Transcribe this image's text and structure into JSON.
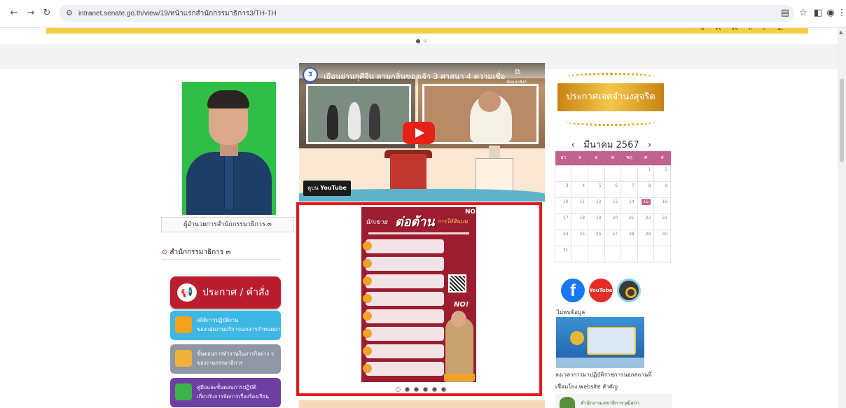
{
  "browser": {
    "url": "intranet.senate.go.th/view/19/หน้าแรกสำนักกรรมาธิการ3/TH-TH"
  },
  "left": {
    "portrait_caption": "ผู้อำนวยการสำนักกรรมาธิการ ๓",
    "section_title": "สำนักกรรมาธิการ ๓",
    "announce_label": "ประกาศ / คำสั่ง",
    "buttons": [
      {
        "line1": "สถิติการปฏิบัติงาน",
        "line2": "ของกลุ่มงานบริการเอกสารกำหนดมา",
        "color": "#3fb7e4",
        "icon_color": "#f4a31b"
      },
      {
        "line1": "ขั้นตอนการทำงานในภารกิจต่าง ๆ",
        "line2": "ของงานกรรมาธิการ",
        "color": "#8e97a3",
        "icon_color": "#f0b339"
      },
      {
        "line1": "คู่มือและขั้นตอนการปฏิบัติ",
        "line2": "เกี่ยวกับการจัดการเรื่องร้องเรียน",
        "color": "#6e3fa3",
        "icon_color": "#3bb34a"
      }
    ]
  },
  "center": {
    "video": {
      "channel_badge": "3",
      "title": "เยือนย่านกุศีจีน ตามกลิ่นของเจ้า 3 ศาสนา 4 ความเชื่อ",
      "copy_label": "คัดลอกลิงก์",
      "watch_label": "ดูบน",
      "youtube_label": "YouTube"
    },
    "poster": {
      "title_a": "นักเขาย",
      "title_b": "ต่อต้าน",
      "title_c": "การให้สินบน",
      "no_badge": "NO",
      "no_stamp": "NO!",
      "rows": 8
    },
    "carousel": {
      "total": 6,
      "active": 0
    }
  },
  "right": {
    "integrity_label": "ประกาศเจตจำนงสุจริต",
    "calendar": {
      "prev": "‹",
      "next": "›",
      "month_year": "มีนาคม 2567",
      "weekdays": [
        "อา",
        "จ",
        "อ",
        "พ",
        "พฤ",
        "ศ",
        "ส"
      ],
      "weeks": [
        [
          "",
          "",
          "",
          "",
          "",
          "1",
          "2"
        ],
        [
          "3",
          "4",
          "5",
          "6",
          "7",
          "8",
          "9"
        ],
        [
          "10",
          "11",
          "12",
          "13",
          "14",
          "15",
          "16"
        ],
        [
          "17",
          "18",
          "19",
          "20",
          "21",
          "22",
          "23"
        ],
        [
          "24",
          "25",
          "26",
          "27",
          "28",
          "29",
          "30"
        ],
        [
          "31",
          "",
          "",
          "",
          "",
          "",
          ""
        ]
      ],
      "today": "15",
      "accent": "#c0628e"
    },
    "social": {
      "facebook": "f",
      "youtube": "YouTube"
    },
    "no_data": "ไม่พบข้อมูล",
    "portal_caption": "ลงเวลาการมาปฏิบัติราชการนอกสถานที่",
    "links_title": "เชื่อมโยง website สำคัญ",
    "bottom_card": "สำนักงานเลขาธิการวุฒิสภา"
  }
}
